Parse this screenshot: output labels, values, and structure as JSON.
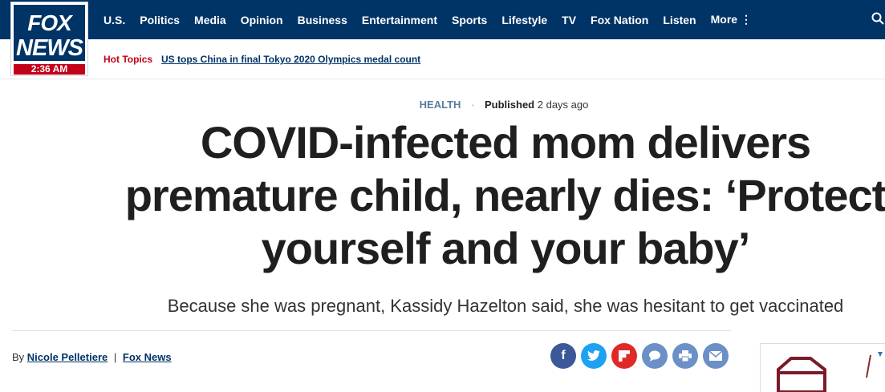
{
  "logo": {
    "line1": "FOX",
    "line2": "NEWS",
    "time": "2:36 AM"
  },
  "nav": {
    "items": [
      "U.S.",
      "Politics",
      "Media",
      "Opinion",
      "Business",
      "Entertainment",
      "Sports",
      "Lifestyle",
      "TV",
      "Fox Nation",
      "Listen",
      "More ⋮"
    ],
    "search_icon": "search-icon"
  },
  "hot_topics": {
    "label": "Hot Topics",
    "link": "US tops China in final Tokyo 2020 Olympics medal count"
  },
  "article": {
    "category": "HEALTH",
    "published_label": "Published",
    "published_time": "2 days ago",
    "headline": "COVID-infected mom delivers premature child, nearly dies: ‘Protect yourself and your baby’",
    "subhead": "Because she was pregnant, Kassidy Hazelton said, she was hesitant to get vaccinated",
    "byline_prefix": "By",
    "author": "Nicole Pelletiere",
    "separator": "|",
    "source": "Fox News"
  },
  "share": {
    "buttons": [
      {
        "name": "facebook-share-button",
        "icon": "f",
        "color": "#3b5998"
      },
      {
        "name": "twitter-share-button",
        "icon": "🐦",
        "color": "#1da1f2"
      },
      {
        "name": "flipboard-share-button",
        "icon": "F",
        "color": "#e12828"
      },
      {
        "name": "comments-share-button",
        "icon": "💬",
        "color": "#6b8fc7"
      },
      {
        "name": "print-share-button",
        "icon": "⎙",
        "color": "#6b8fc7"
      },
      {
        "name": "email-share-button",
        "icon": "✉",
        "color": "#6b8fc7"
      }
    ]
  },
  "colors": {
    "brand": "#003366",
    "accent": "#c20017"
  }
}
